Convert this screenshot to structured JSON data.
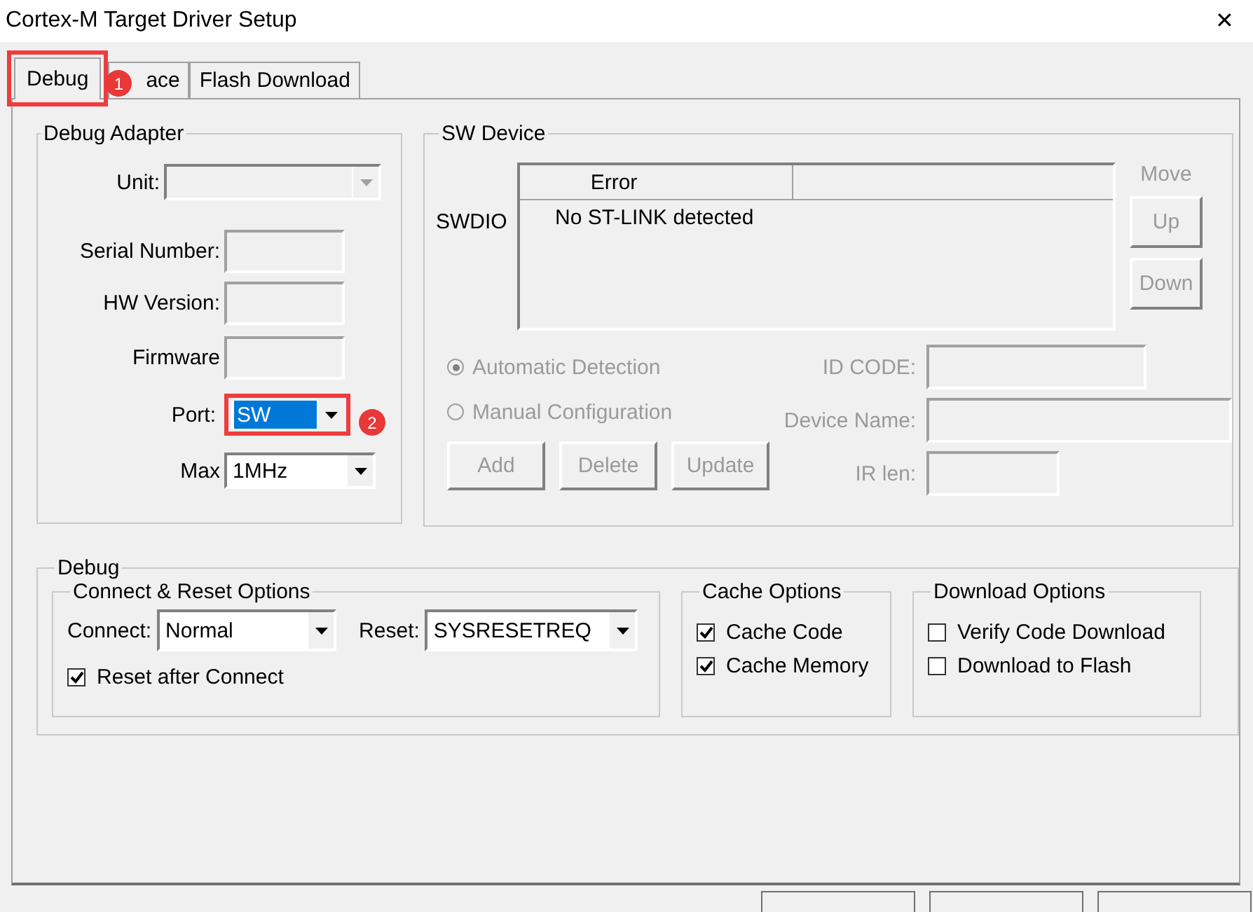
{
  "window": {
    "title": "Cortex-M Target Driver Setup",
    "close": "✕"
  },
  "tabs": [
    {
      "label": "Debug",
      "selected": true,
      "callout": "1"
    },
    {
      "label": "ace",
      "selected": false
    },
    {
      "label": "Flash Download",
      "selected": false
    }
  ],
  "debug_adapter": {
    "title": "Debug Adapter",
    "rows": [
      {
        "label": "Unit:",
        "kind": "combo",
        "disabled": true,
        "focused": false
      },
      {
        "label": "Serial Number:",
        "kind": "field"
      },
      {
        "label": "HW Version:",
        "kind": "field"
      },
      {
        "label": "Firmware",
        "kind": "field"
      },
      {
        "label": "Port:",
        "kind": "combo",
        "value": "SW",
        "disabled": false,
        "focused": true,
        "callout": "2"
      },
      {
        "label": "Max",
        "kind": "combo",
        "value": "1MHz",
        "disabled": false,
        "focused": false
      }
    ]
  },
  "sw_device": {
    "title": "SW Device",
    "side_label": "SWDIO",
    "table": {
      "columns": [
        "Error"
      ],
      "rows": [
        {
          "cells": [
            "No ST-LINK detected"
          ]
        }
      ]
    },
    "move": {
      "label": "Move",
      "buttons": [
        {
          "label": "Up",
          "disabled": true
        },
        {
          "label": "Down",
          "disabled": true
        }
      ]
    },
    "radios": [
      {
        "label": "Automatic Detection",
        "selected": true,
        "disabled": true
      },
      {
        "label": "Manual Configuration",
        "selected": false,
        "disabled": true
      }
    ],
    "buttons": [
      {
        "label": "Add",
        "disabled": true
      },
      {
        "label": "Delete",
        "disabled": true
      },
      {
        "label": "Update",
        "disabled": true
      }
    ],
    "fields": [
      {
        "label": "ID CODE:"
      },
      {
        "label": "Device Name:"
      },
      {
        "label": "IR len:"
      }
    ]
  },
  "debug": {
    "title": "Debug",
    "connect_reset": {
      "title": "Connect & Reset Options",
      "combos": [
        {
          "label": "Connect:",
          "value": "Normal"
        },
        {
          "label": "Reset:",
          "value": "SYSRESETREQ"
        }
      ],
      "checkboxes": [
        {
          "label": "Reset after Connect",
          "checked": true
        }
      ]
    },
    "cache": {
      "title": "Cache Options",
      "checkboxes": [
        {
          "label": "Cache Code",
          "checked": true
        },
        {
          "label": "Cache Memory",
          "checked": true
        }
      ]
    },
    "download": {
      "title": "Download Options",
      "checkboxes": [
        {
          "label": "Verify Code Download",
          "checked": false
        },
        {
          "label": "Download to Flash",
          "checked": false
        }
      ]
    }
  }
}
